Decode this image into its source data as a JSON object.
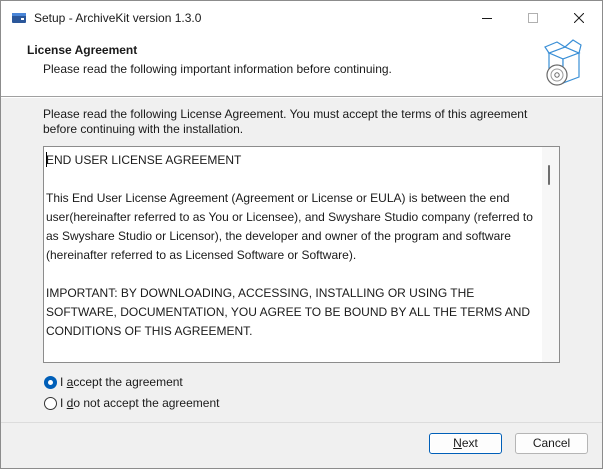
{
  "window": {
    "title": "Setup - ArchiveKit version 1.3.0"
  },
  "header": {
    "title": "License Agreement",
    "subtitle": "Please read the following important information before continuing.",
    "icon": "software-box-icon"
  },
  "intro_text": "Please read the following License Agreement. You must accept the terms of this agreement before continuing with the installation.",
  "license": {
    "text": "END USER LICENSE AGREEMENT\n\nThis End User License Agreement (Agreement or License or EULA) is between the end user(hereinafter referred to as You or Licensee), and Swyshare Studio company (referred to as Swyshare Studio or Licensor), the developer and owner of the program and software (hereinafter referred to as Licensed Software or Software).\n\nIMPORTANT: BY DOWNLOADING, ACCESSING, INSTALLING OR USING THE SOFTWARE, DOCUMENTATION, YOU AGREE TO BE BOUND BY ALL THE TERMS AND CONDITIONS OF THIS AGREEMENT."
  },
  "options": {
    "accept": {
      "prefix": "I ",
      "accel": "a",
      "rest": "ccept the agreement",
      "selected": true
    },
    "decline": {
      "prefix": "I ",
      "accel": "d",
      "rest": "o not accept the agreement",
      "selected": false
    }
  },
  "buttons": {
    "next": {
      "accel": "N",
      "rest": "ext"
    },
    "cancel": "Cancel"
  },
  "colors": {
    "accent": "#005fb8",
    "window_bg": "#f0f0f0"
  }
}
